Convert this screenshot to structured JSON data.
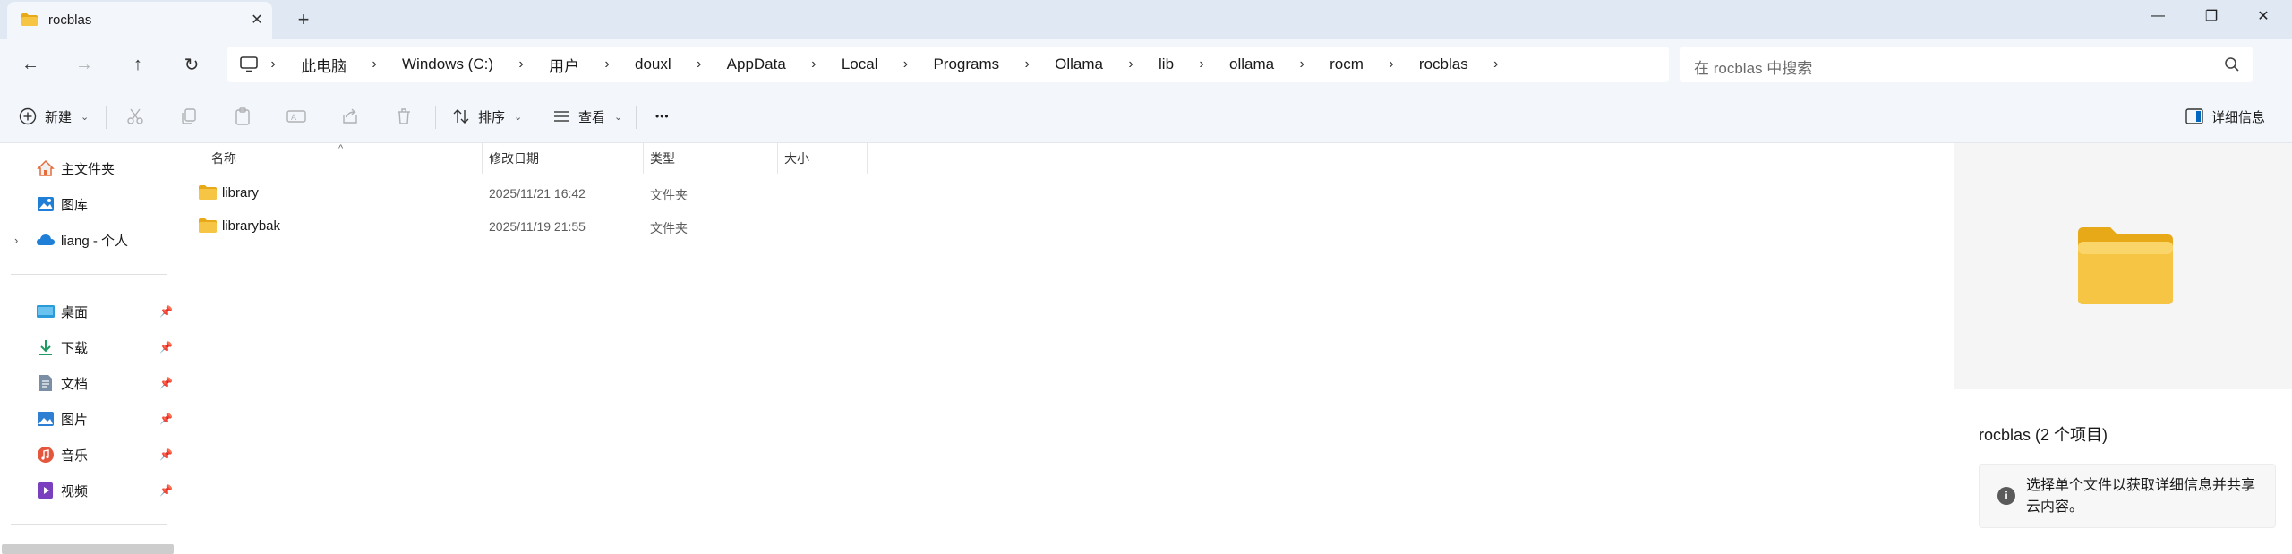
{
  "window": {
    "tab_title": "rocblas",
    "tab_close_glyph": "✕",
    "new_tab_glyph": "+",
    "minimize_glyph": "—",
    "restore_glyph": "❐",
    "close_glyph": "✕"
  },
  "nav": {
    "back_glyph": "←",
    "forward_glyph": "→",
    "up_glyph": "↑",
    "refresh_glyph": "↻"
  },
  "breadcrumb": {
    "separator": "›",
    "items": [
      "此电脑",
      "Windows (C:)",
      "用户",
      "douxl",
      "AppData",
      "Local",
      "Programs",
      "Ollama",
      "lib",
      "ollama",
      "rocm",
      "rocblas"
    ]
  },
  "search": {
    "placeholder": "在 rocblas 中搜索"
  },
  "toolbar": {
    "new_label": "新建",
    "sort_label": "排序",
    "view_label": "查看",
    "more_glyph": "•••",
    "details_label": "详细信息",
    "chevron": "⌄"
  },
  "sidebar": {
    "home_label": "主文件夹",
    "gallery_label": "图库",
    "onedrive_label": "liang - 个人",
    "expander": "›",
    "pin_glyph": "📌",
    "quick_access": [
      {
        "label": "桌面"
      },
      {
        "label": "下载"
      },
      {
        "label": "文档"
      },
      {
        "label": "图片"
      },
      {
        "label": "音乐"
      },
      {
        "label": "视频"
      }
    ]
  },
  "filelist": {
    "columns": {
      "name": "名称",
      "modified": "修改日期",
      "type": "类型",
      "size": "大小"
    },
    "sort_glyph": "^",
    "rows": [
      {
        "name": "library",
        "modified": "2025/11/21 16:42",
        "type": "文件夹",
        "size": ""
      },
      {
        "name": "librarybak",
        "modified": "2025/11/19 21:55",
        "type": "文件夹",
        "size": ""
      }
    ]
  },
  "details": {
    "title": "rocblas (2 个项目)",
    "info_glyph": "i",
    "info_text": "选择单个文件以获取详细信息并共享云内容。"
  },
  "colors": {
    "titlebar_bg": "#dfe8f3",
    "chrome_bg": "#f3f6fb",
    "folder_yellow": "#f6c543",
    "folder_dark": "#e8a918",
    "accent_blue": "#0067c0"
  }
}
